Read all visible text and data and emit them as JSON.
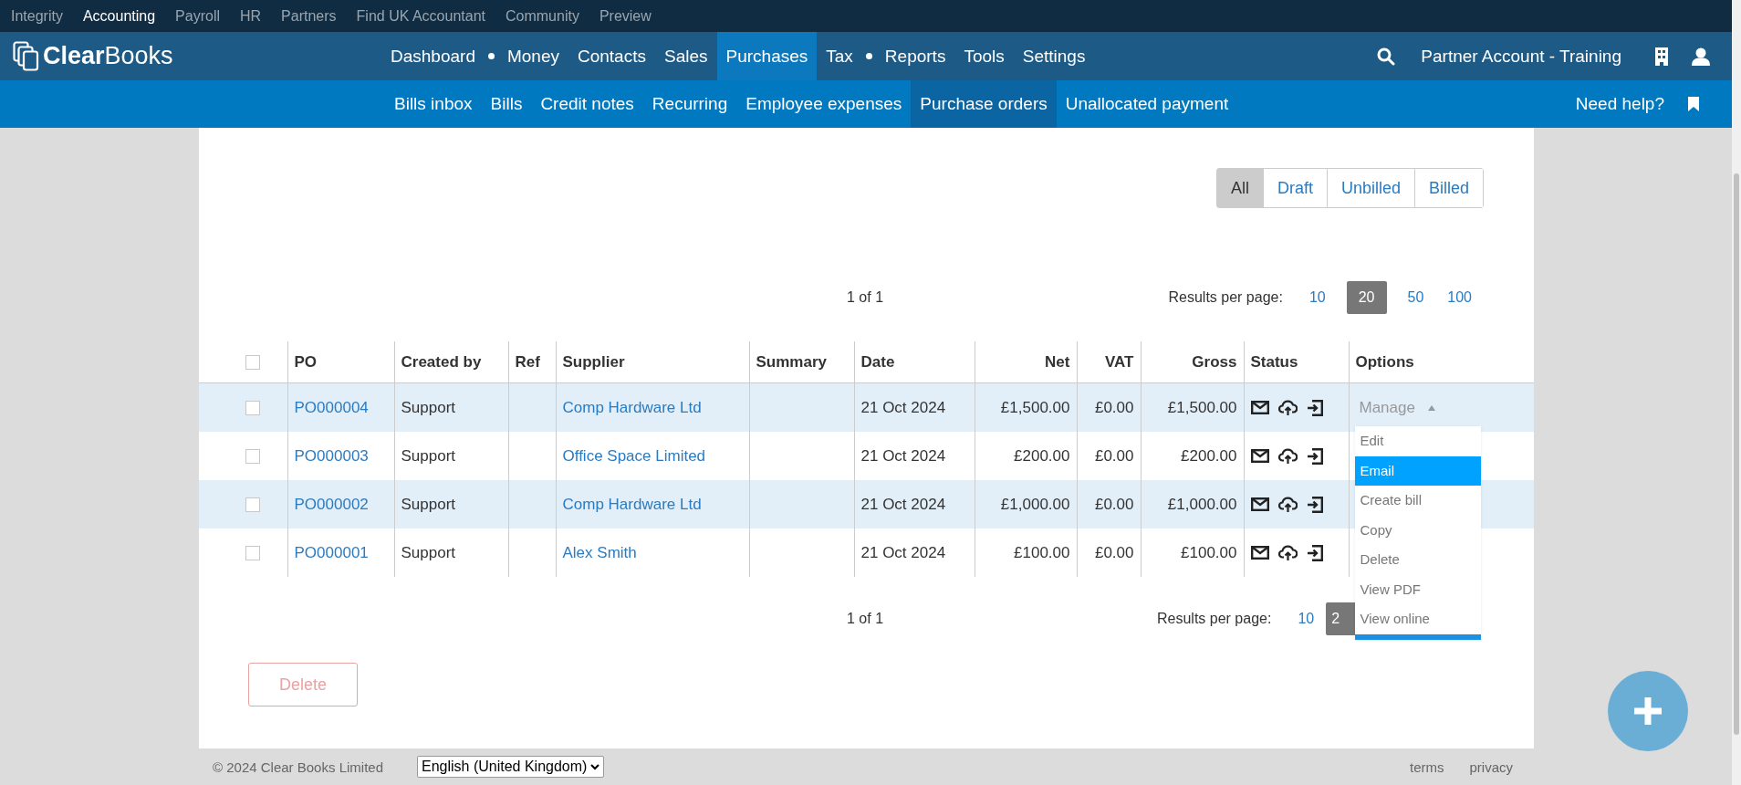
{
  "top_bar": {
    "items": [
      {
        "label": "Integrity",
        "selected": false
      },
      {
        "label": "Accounting",
        "selected": true
      },
      {
        "label": "Payroll",
        "selected": false
      },
      {
        "label": "HR",
        "selected": false
      },
      {
        "label": "Partners",
        "selected": false
      },
      {
        "label": "Find UK Accountant",
        "selected": false
      },
      {
        "label": "Community",
        "selected": false
      },
      {
        "label": "Preview",
        "selected": false
      }
    ]
  },
  "header": {
    "logo": "**Clear**Books",
    "nav": [
      {
        "label": "Dashboard",
        "selected": false,
        "dot_after": true
      },
      {
        "label": "Money",
        "selected": false,
        "dot_after": false
      },
      {
        "label": "Contacts",
        "selected": false,
        "dot_after": false
      },
      {
        "label": "Sales",
        "selected": false,
        "dot_after": false
      },
      {
        "label": "Purchases",
        "selected": true,
        "dot_after": false
      },
      {
        "label": "Tax",
        "selected": false,
        "dot_after": true
      },
      {
        "label": "Reports",
        "selected": false,
        "dot_after": false
      },
      {
        "label": "Tools",
        "selected": false,
        "dot_after": false
      },
      {
        "label": "Settings",
        "selected": false,
        "dot_after": false
      }
    ],
    "account": "Partner Account - Training"
  },
  "subnav": {
    "items": [
      {
        "label": "Bills inbox",
        "selected": false
      },
      {
        "label": "Bills",
        "selected": false
      },
      {
        "label": "Credit notes",
        "selected": false
      },
      {
        "label": "Recurring",
        "selected": false
      },
      {
        "label": "Employee expenses",
        "selected": false
      },
      {
        "label": "Purchase orders",
        "selected": true
      },
      {
        "label": "Unallocated payment",
        "selected": false
      }
    ],
    "help": "Need help?"
  },
  "filters": [
    {
      "label": "All",
      "selected": true
    },
    {
      "label": "Draft",
      "selected": false
    },
    {
      "label": "Unbilled",
      "selected": false
    },
    {
      "label": "Billed",
      "selected": false
    }
  ],
  "pager_top": {
    "summary": "1 of 1",
    "label": "Results per page:",
    "sizes": [
      {
        "label": "10",
        "selected": false
      },
      {
        "label": "20",
        "selected": true
      },
      {
        "label": "50",
        "selected": false
      },
      {
        "label": "100",
        "selected": false
      }
    ]
  },
  "table": {
    "header_checked": false,
    "columns": [
      {
        "label": "PO",
        "right_aligned": false
      },
      {
        "label": "Created by",
        "right_aligned": false
      },
      {
        "label": "Ref",
        "right_aligned": false
      },
      {
        "label": "Supplier",
        "right_aligned": false
      },
      {
        "label": "Summary",
        "right_aligned": false
      },
      {
        "label": "Date",
        "right_aligned": false
      },
      {
        "label": "Net",
        "right_aligned": true
      },
      {
        "label": "VAT",
        "right_aligned": true
      },
      {
        "label": "Gross",
        "right_aligned": true
      },
      {
        "label": "Status",
        "right_aligned": false
      },
      {
        "label": "Options",
        "right_aligned": false
      }
    ],
    "rows": [
      {
        "checked": false,
        "po": "PO000004",
        "created_by": "Support",
        "supplier": "Comp Hardware Ltd",
        "date": "21 Oct 2024",
        "net": "£1,500.00",
        "vat": "£0.00",
        "gross": "£1,500.00",
        "options": "Manage"
      },
      {
        "checked": false,
        "po": "PO000003",
        "created_by": "Support",
        "supplier": "Office Space Limited",
        "date": "21 Oct 2024",
        "net": "£200.00",
        "vat": "£0.00",
        "gross": "£200.00"
      },
      {
        "checked": false,
        "po": "PO000002",
        "created_by": "Support",
        "supplier": "Comp Hardware Ltd",
        "date": "21 Oct 2024",
        "net": "£1,000.00",
        "vat": "£0.00",
        "gross": "£1,000.00"
      },
      {
        "checked": false,
        "po": "PO000001",
        "created_by": "Support",
        "supplier": "Alex Smith",
        "date": "21 Oct 2024",
        "net": "£100.00",
        "vat": "£0.00",
        "gross": "£100.00"
      }
    ]
  },
  "menu": {
    "items": [
      {
        "label": "Edit",
        "selected": false
      },
      {
        "label": "Email",
        "selected": true
      },
      {
        "label": "Create bill",
        "selected": false
      },
      {
        "label": "Copy",
        "selected": false
      },
      {
        "label": "Delete",
        "selected": false
      },
      {
        "label": "View PDF",
        "selected": false
      },
      {
        "label": "View online",
        "selected": false
      }
    ]
  },
  "pager_bottom": {
    "summary": "1 of 1",
    "label": "Results per page:",
    "sizes": [
      {
        "label": "10",
        "selected": false
      },
      {
        "label": "2",
        "selected": true
      }
    ]
  },
  "delete_button": {
    "label": "Delete",
    "disabled": true
  },
  "footer": {
    "copyright": "© 2024 Clear Books Limited",
    "language": "English (United Kingdom)",
    "links": [
      "terms",
      "privacy"
    ]
  }
}
